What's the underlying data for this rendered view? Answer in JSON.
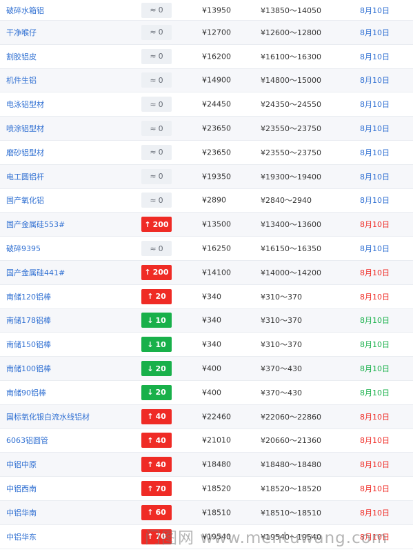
{
  "currency_symbol": "¥",
  "colors": {
    "name_link": "#2f6fd2",
    "up": "#ef2b25",
    "down": "#18b04a",
    "flat_badge_bg": "#edf0f4"
  },
  "icons": {
    "flat": "approx-equal-icon",
    "up": "arrow-up-icon",
    "down": "arrow-down-icon"
  },
  "rows": [
    {
      "name": "破碎水箱铝",
      "trend": "flat",
      "change": "0",
      "price": "¥13950",
      "range": "¥13850～14050",
      "date": "8月10日"
    },
    {
      "name": "干净喉仔",
      "trend": "flat",
      "change": "0",
      "price": "¥12700",
      "range": "¥12600～12800",
      "date": "8月10日"
    },
    {
      "name": "割胶铝皮",
      "trend": "flat",
      "change": "0",
      "price": "¥16200",
      "range": "¥16100～16300",
      "date": "8月10日"
    },
    {
      "name": "机件生铝",
      "trend": "flat",
      "change": "0",
      "price": "¥14900",
      "range": "¥14800～15000",
      "date": "8月10日"
    },
    {
      "name": "电泳铝型材",
      "trend": "flat",
      "change": "0",
      "price": "¥24450",
      "range": "¥24350～24550",
      "date": "8月10日"
    },
    {
      "name": "喷涂铝型材",
      "trend": "flat",
      "change": "0",
      "price": "¥23650",
      "range": "¥23550～23750",
      "date": "8月10日"
    },
    {
      "name": "磨砂铝型材",
      "trend": "flat",
      "change": "0",
      "price": "¥23650",
      "range": "¥23550～23750",
      "date": "8月10日"
    },
    {
      "name": "电工圆铝杆",
      "trend": "flat",
      "change": "0",
      "price": "¥19350",
      "range": "¥19300～19400",
      "date": "8月10日"
    },
    {
      "name": "国产氧化铝",
      "trend": "flat",
      "change": "0",
      "price": "¥2890",
      "range": "¥2840～2940",
      "date": "8月10日"
    },
    {
      "name": "国产金属硅553#",
      "trend": "up",
      "change": "200",
      "price": "¥13500",
      "range": "¥13400～13600",
      "date": "8月10日"
    },
    {
      "name": "破碎9395",
      "trend": "flat",
      "change": "0",
      "price": "¥16250",
      "range": "¥16150～16350",
      "date": "8月10日"
    },
    {
      "name": "国产金属硅441#",
      "trend": "up",
      "change": "200",
      "price": "¥14100",
      "range": "¥14000～14200",
      "date": "8月10日"
    },
    {
      "name": "南储120铝棒",
      "trend": "up",
      "change": "20",
      "price": "¥340",
      "range": "¥310～370",
      "date": "8月10日"
    },
    {
      "name": "南储178铝棒",
      "trend": "down",
      "change": "10",
      "price": "¥340",
      "range": "¥310～370",
      "date": "8月10日"
    },
    {
      "name": "南储150铝棒",
      "trend": "down",
      "change": "10",
      "price": "¥340",
      "range": "¥310～370",
      "date": "8月10日"
    },
    {
      "name": "南储100铝棒",
      "trend": "down",
      "change": "20",
      "price": "¥400",
      "range": "¥370～430",
      "date": "8月10日"
    },
    {
      "name": "南储90铝棒",
      "trend": "down",
      "change": "20",
      "price": "¥400",
      "range": "¥370～430",
      "date": "8月10日"
    },
    {
      "name": "国标氧化银白流水线铝材",
      "trend": "up",
      "change": "40",
      "price": "¥22460",
      "range": "¥22060～22860",
      "date": "8月10日"
    },
    {
      "name": "6063铝圆管",
      "trend": "up",
      "change": "40",
      "price": "¥21010",
      "range": "¥20660～21360",
      "date": "8月10日"
    },
    {
      "name": "中铝中原",
      "trend": "up",
      "change": "40",
      "price": "¥18480",
      "range": "¥18480～18480",
      "date": "8月10日"
    },
    {
      "name": "中铝西南",
      "trend": "up",
      "change": "70",
      "price": "¥18520",
      "range": "¥18520～18520",
      "date": "8月10日"
    },
    {
      "name": "中铝华南",
      "trend": "up",
      "change": "60",
      "price": "¥18510",
      "range": "¥18510～18510",
      "date": "8月10日"
    },
    {
      "name": "中铝华东",
      "trend": "up",
      "change": "70",
      "price": "¥19540",
      "range": "¥19540～19540",
      "date": "8月10日"
    }
  ],
  "watermark_text": "门图网 www.mentuwang.com"
}
